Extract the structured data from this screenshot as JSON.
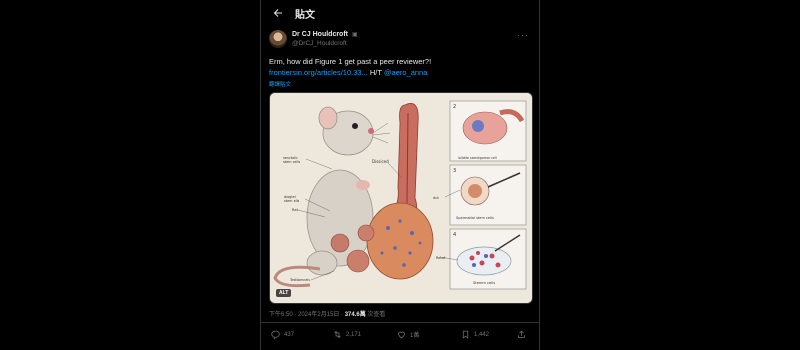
{
  "header": {
    "title": "貼文"
  },
  "author": {
    "name": "Dr CJ Houldcroft",
    "handle": "@DrCJ_Houldcroft"
  },
  "tweet": {
    "text": "Erm, how did Figure 1 get past a peer reviewer?!",
    "link": "frontiersin.org/articles/10.33...",
    "ht_prefix": " H/T ",
    "mention": "@aero_anna",
    "translate": "翻譯貼文"
  },
  "media": {
    "alt_badge": "ALT",
    "labels": {
      "serotonin_stem": "senctolic\nstem cells",
      "dissiced": "Dissiced",
      "iollotte": "iollotte sserotgomar cell",
      "dck": "dck",
      "retat": "Retat",
      "diogtel": "diοgtel\nstem ells",
      "rat": "Rat",
      "testtomcels": "Testtomcels",
      "spermatial": "Spermatial stem cells",
      "stemm": "Stemm cells",
      "panel_2": "2",
      "panel_3": "3",
      "panel_4": "4"
    }
  },
  "meta": {
    "time": "下午6:50 · 2024年2月15日 · ",
    "views_count": "374.6萬",
    "views_label": " 次查看"
  },
  "actions": {
    "replies": "437",
    "reposts": "2,171",
    "likes": "1萬",
    "bookmarks": "1,442"
  }
}
